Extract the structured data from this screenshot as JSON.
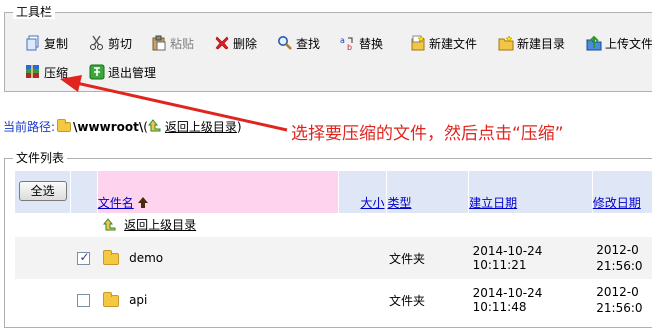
{
  "toolbar": {
    "legend": "工具栏",
    "buttons": [
      {
        "label": "复制",
        "icon": "copy-icon"
      },
      {
        "label": "剪切",
        "icon": "scissors-icon"
      },
      {
        "label": "粘贴",
        "icon": "paste-icon",
        "disabled": true
      },
      {
        "label": "删除",
        "icon": "delete-x-icon"
      },
      {
        "label": "查找",
        "icon": "magnifier-icon"
      },
      {
        "label": "替换",
        "icon": "replace-icon"
      },
      {
        "label": "新建文件",
        "icon": "new-file-icon"
      },
      {
        "label": "新建目录",
        "icon": "new-folder-icon"
      },
      {
        "label": "上传文件",
        "icon": "upload-icon"
      },
      {
        "label": "压缩",
        "icon": "archive-books-icon"
      },
      {
        "label": "退出管理",
        "icon": "exit-icon"
      }
    ]
  },
  "path": {
    "label": "当前路径:",
    "value": "\\wwwroot\\",
    "open_paren": "(",
    "up_link": "返回上级目录",
    "close_paren": ")"
  },
  "annotation": "选择要压缩的文件，然后点击“压缩”",
  "filelist": {
    "legend": "文件列表",
    "select_all": "全选",
    "columns": {
      "name": "文件名",
      "size": "大小",
      "type": "类型",
      "created": "建立日期",
      "modified": "修改日期"
    },
    "up_row_label": "返回上级目录",
    "rows": [
      {
        "checked": true,
        "name": "demo",
        "size": "",
        "type": "文件夹",
        "created": "2014-10-24 10:11:21",
        "modified_1": "2012-0",
        "modified_2": "21:56:0"
      },
      {
        "checked": false,
        "name": "api",
        "size": "",
        "type": "文件夹",
        "created": "2014-10-24 10:11:48",
        "modified_1": "2012-0",
        "modified_2": "21:56:0"
      }
    ]
  },
  "colors": {
    "annotation_red": "#e0241e",
    "header_blue": "#dfe6f5",
    "header_pink": "#fdd3ee",
    "link_blue": "#0000cc"
  }
}
